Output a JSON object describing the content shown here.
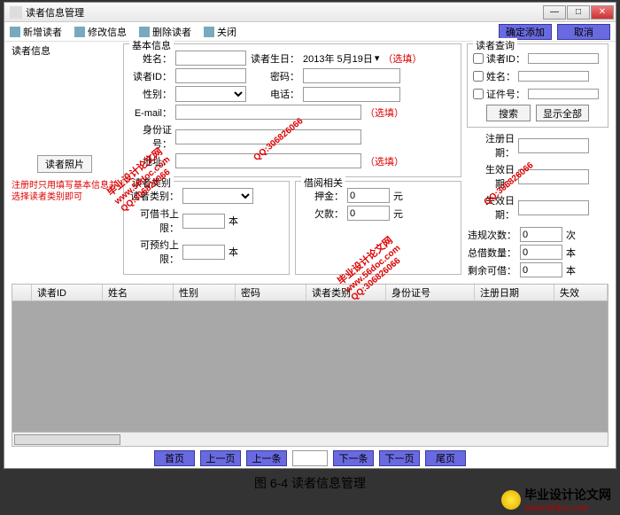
{
  "window": {
    "title": "读者信息管理"
  },
  "toolbar": {
    "add": "新增读者",
    "edit": "修改信息",
    "del": "删除读者",
    "close": "关闭",
    "confirm": "确定添加",
    "cancel": "取消"
  },
  "left": {
    "section": "读者信息",
    "photo": "读者照片",
    "tip": "注册时只用填写基本信息并选择读者类别即可"
  },
  "basic": {
    "title": "基本信息",
    "name": "姓名：",
    "birthday": "读者生日：",
    "birthday_val": "2013年 5月19日",
    "reader_id": "读者ID：",
    "password": "密码：",
    "gender": "性别：",
    "phone": "电话：",
    "email": "E-mail：",
    "idcard": "身份证号：",
    "address": "地址：",
    "opt": "（选填）"
  },
  "query": {
    "title": "读者查询",
    "by_id": "读者ID：",
    "by_name": "姓名：",
    "by_idcard": "证件号：",
    "search": "搜索",
    "show_all": "显示全部"
  },
  "dates": {
    "reg": "注册日期：",
    "eff": "生效日期：",
    "exp": "失效日期："
  },
  "cat": {
    "title": "读者类别",
    "type": "读者类别：",
    "borrow_limit": "可借书上限：",
    "reserve_limit": "可预约上限：",
    "unit": "本"
  },
  "loan": {
    "title": "借阅相关",
    "deposit": "押金：",
    "deposit_v": "0",
    "owe": "欠款：",
    "owe_v": "0",
    "yuan": "元",
    "violations": "违规次数：",
    "violations_v": "0",
    "times": "次",
    "total_borrow": "总借数量：",
    "total_borrow_v": "0",
    "remain": "剩余可借：",
    "remain_v": "0"
  },
  "grid": {
    "c1": "读者ID",
    "c2": "姓名",
    "c3": "性别",
    "c4": "密码",
    "c5": "读者类别",
    "c6": "身份证号",
    "c7": "注册日期",
    "c8": "失效"
  },
  "pager": {
    "first": "首页",
    "prev_page": "上一页",
    "prev": "上一条",
    "next": "下一条",
    "next_page": "下一页",
    "last": "尾页"
  },
  "caption": "图 6-4 读者信息管理",
  "footer": {
    "brand": "毕业设计论文网",
    "url": "www.56doc.com"
  },
  "wm": {
    "brand": "毕业设计论文网",
    "url": "www.56doc.com",
    "qq": "QQ:306826066"
  }
}
